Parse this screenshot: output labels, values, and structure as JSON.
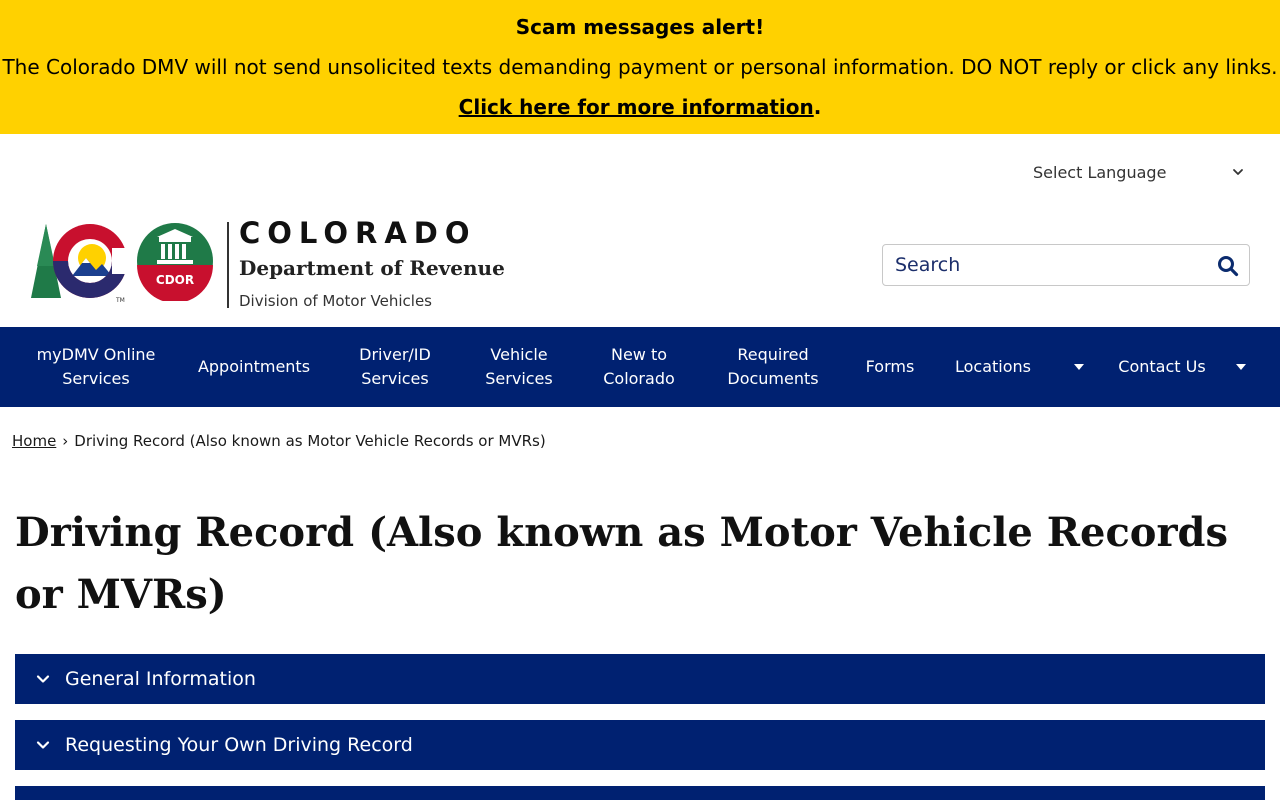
{
  "alert": {
    "title": "Scam messages alert!",
    "text": "The Colorado DMV will not send unsolicited texts demanding payment or personal information. DO NOT reply or click any links.",
    "link": "Click here for more information",
    "link_suffix": "."
  },
  "language": {
    "label": "Select Language"
  },
  "logo": {
    "state": "COLORADO",
    "department": "Department of Revenue",
    "division": "Division of Motor Vehicles",
    "seal_text": "CDOR"
  },
  "search": {
    "placeholder": "Search"
  },
  "nav": {
    "items": [
      {
        "label": "myDMV Online Services"
      },
      {
        "label": "Appointments"
      },
      {
        "label": "Driver/ID Services"
      },
      {
        "label": "Vehicle Services"
      },
      {
        "label": "New to Colorado"
      },
      {
        "label": "Required Documents"
      },
      {
        "label": "Forms"
      },
      {
        "label": "Locations"
      },
      {
        "label": "Contact Us"
      }
    ]
  },
  "breadcrumb": {
    "home": "Home",
    "separator": "›",
    "current": "Driving Record (Also known as Motor Vehicle Records or MVRs)"
  },
  "page": {
    "title": "Driving Record (Also known as Motor Vehicle Records or MVRs)"
  },
  "accordion": [
    {
      "label": "General Information"
    },
    {
      "label": "Requesting Your Own Driving Record"
    },
    {
      "label": ""
    }
  ],
  "colors": {
    "alert_bg": "#ffd100",
    "nav_bg": "#002171",
    "accordion_bg": "#002171",
    "logo_red": "#c8102e",
    "logo_green": "#1f7a48",
    "logo_blue": "#1b3f8f",
    "logo_yellow": "#ffd100"
  },
  "icons": [
    "chevron-down-icon",
    "search-icon",
    "caret-down-icon",
    "colorado-c-logo",
    "cdor-seal-logo"
  ]
}
